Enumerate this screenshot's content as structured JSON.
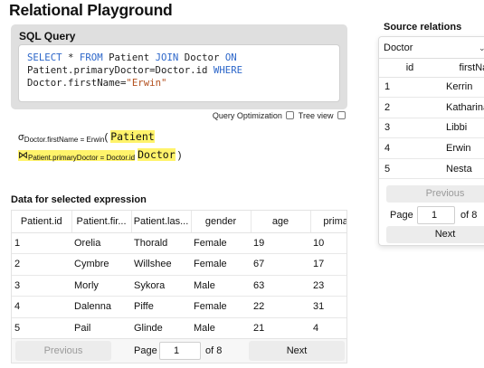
{
  "app": {
    "title": "Relational Playground"
  },
  "sql": {
    "header": "SQL Query",
    "line1": {
      "kw1": "SELECT",
      "star": " * ",
      "kw2": "FROM",
      "t1": " Patient ",
      "kw3": "JOIN",
      "t2": " Doctor ",
      "kw4": "ON"
    },
    "line2": {
      "text": "Patient.primaryDoctor=Doctor.id ",
      "kw": "WHERE"
    },
    "line3": {
      "text": "Doctor.firstName=",
      "str": "\"Erwin\""
    }
  },
  "options": {
    "query_optimization": "Query Optimization",
    "tree_view": "Tree view"
  },
  "expression": {
    "sigma": "σ",
    "sigma_sub": "Doctor.firstName = Erwin",
    "open_paren": "(",
    "rel1": "Patient",
    "join": "⋈",
    "join_sub": "Patient.primaryDoctor = Doctor.id",
    "rel2": "Doctor",
    "close_paren": ")"
  },
  "data_section": {
    "title": "Data for selected expression",
    "columns": [
      "Patient.id",
      "Patient.fir...",
      "Patient.las...",
      "gender",
      "age",
      "primar"
    ],
    "rows": [
      [
        "1",
        "Orelia",
        "Thorald",
        "Female",
        "19",
        "10"
      ],
      [
        "2",
        "Cymbre",
        "Willshee",
        "Female",
        "67",
        "17"
      ],
      [
        "3",
        "Morly",
        "Sykora",
        "Male",
        "63",
        "23"
      ],
      [
        "4",
        "Dalenna",
        "Piffe",
        "Female",
        "22",
        "31"
      ],
      [
        "5",
        "Pail",
        "Glinde",
        "Male",
        "21",
        "4"
      ]
    ],
    "pager": {
      "previous": "Previous",
      "page_label": "Page",
      "page_value": "1",
      "of_label": "of 8",
      "next": "Next"
    }
  },
  "source": {
    "title": "Source relations",
    "selected": "Doctor",
    "chevron": "⌄",
    "columns": [
      "id",
      "firstNam"
    ],
    "rows": [
      [
        "1",
        "Kerrin"
      ],
      [
        "2",
        "Katharina"
      ],
      [
        "3",
        "Libbi"
      ],
      [
        "4",
        "Erwin"
      ],
      [
        "5",
        "Nesta"
      ]
    ],
    "pager": {
      "previous": "Previous",
      "page_label": "Page",
      "page_value": "1",
      "of_label": "of 8",
      "next": "Next"
    }
  },
  "colors": {
    "keyword": "#2c66c9",
    "string": "#b3501e",
    "highlight": "#fff36b",
    "card": "#dfdfdf"
  }
}
